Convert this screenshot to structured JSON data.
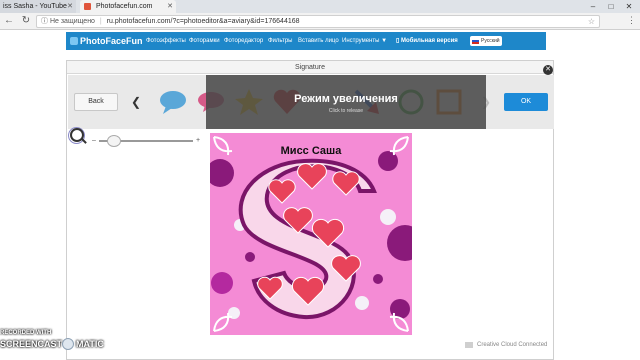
{
  "browser": {
    "tabs": [
      {
        "label": "iss Sasha - YouTube"
      },
      {
        "label": "Photofacefun.com"
      }
    ],
    "address": {
      "secure_label": "Не защищено",
      "url": "ru.photofacefun.com/?c=photoeditor&a=aviary&id=176644168"
    }
  },
  "site": {
    "logo": "PhotoFaceFun",
    "nav": [
      "Фотоэффекты",
      "Фоторамки",
      "Фоторедактор",
      "Фильтры",
      "Вставить лицо",
      "Инструменты ▼"
    ],
    "mobile": "Мобильная версия",
    "language": "Русский"
  },
  "editor": {
    "title": "Signature",
    "back_label": "Back",
    "ok_label": "OK",
    "zoom_mode_title": "Режим увеличения",
    "zoom_mode_hint": "Click to release",
    "zoom_level": 0.1,
    "canvas_caption": "Мисс Саша",
    "status": "Creative Cloud Connected",
    "stickers": [
      "speech-bubble-blue-sticker",
      "speech-bubble-pink-sticker",
      "star-sticker",
      "heart-sticker",
      "arrow-sticker",
      "circle-sticker",
      "square-sticker"
    ],
    "colors": {
      "accent": "#1d8bd8",
      "canvas_bg": "#f48bd5",
      "site_nav": "#1e87c9"
    }
  },
  "watermark": {
    "line1": "RECORDED WITH",
    "line2a": "SCREENCAST",
    "line2b": "MATIC"
  }
}
